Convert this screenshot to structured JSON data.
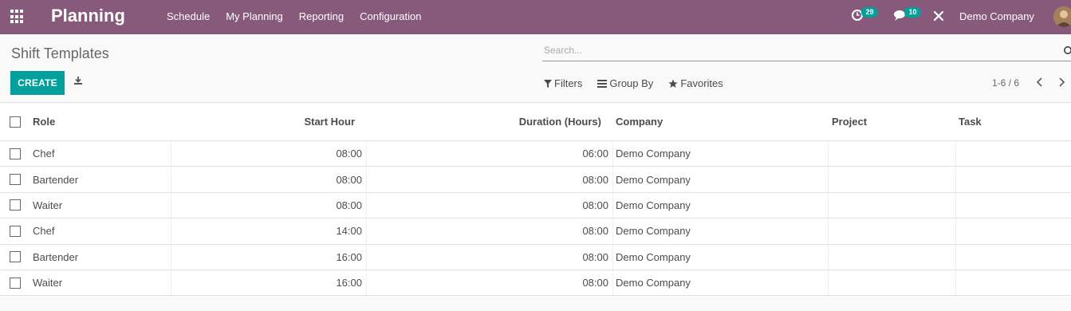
{
  "navbar": {
    "brand": "Planning",
    "menu": [
      {
        "label": "Schedule"
      },
      {
        "label": "My Planning"
      },
      {
        "label": "Reporting"
      },
      {
        "label": "Configuration"
      }
    ],
    "activity_count": "29",
    "message_count": "10",
    "company": "Demo Company",
    "bg_color": "#875a7b"
  },
  "control_panel": {
    "breadcrumb": "Shift Templates",
    "search_placeholder": "Search...",
    "create_label": "CREATE",
    "filters_label": "Filters",
    "group_by_label": "Group By",
    "favorites_label": "Favorites",
    "pager": "1-6 / 6",
    "accent_color": "#00a09d"
  },
  "table": {
    "columns": {
      "role": "Role",
      "start_hour": "Start Hour",
      "duration": "Duration (Hours)",
      "company": "Company",
      "project": "Project",
      "task": "Task"
    },
    "rows": [
      {
        "role": "Chef",
        "start_hour": "08:00",
        "duration": "06:00",
        "company": "Demo Company",
        "project": "",
        "task": ""
      },
      {
        "role": "Bartender",
        "start_hour": "08:00",
        "duration": "08:00",
        "company": "Demo Company",
        "project": "",
        "task": ""
      },
      {
        "role": "Waiter",
        "start_hour": "08:00",
        "duration": "08:00",
        "company": "Demo Company",
        "project": "",
        "task": ""
      },
      {
        "role": "Chef",
        "start_hour": "14:00",
        "duration": "08:00",
        "company": "Demo Company",
        "project": "",
        "task": ""
      },
      {
        "role": "Bartender",
        "start_hour": "16:00",
        "duration": "08:00",
        "company": "Demo Company",
        "project": "",
        "task": ""
      },
      {
        "role": "Waiter",
        "start_hour": "16:00",
        "duration": "08:00",
        "company": "Demo Company",
        "project": "",
        "task": ""
      }
    ]
  }
}
